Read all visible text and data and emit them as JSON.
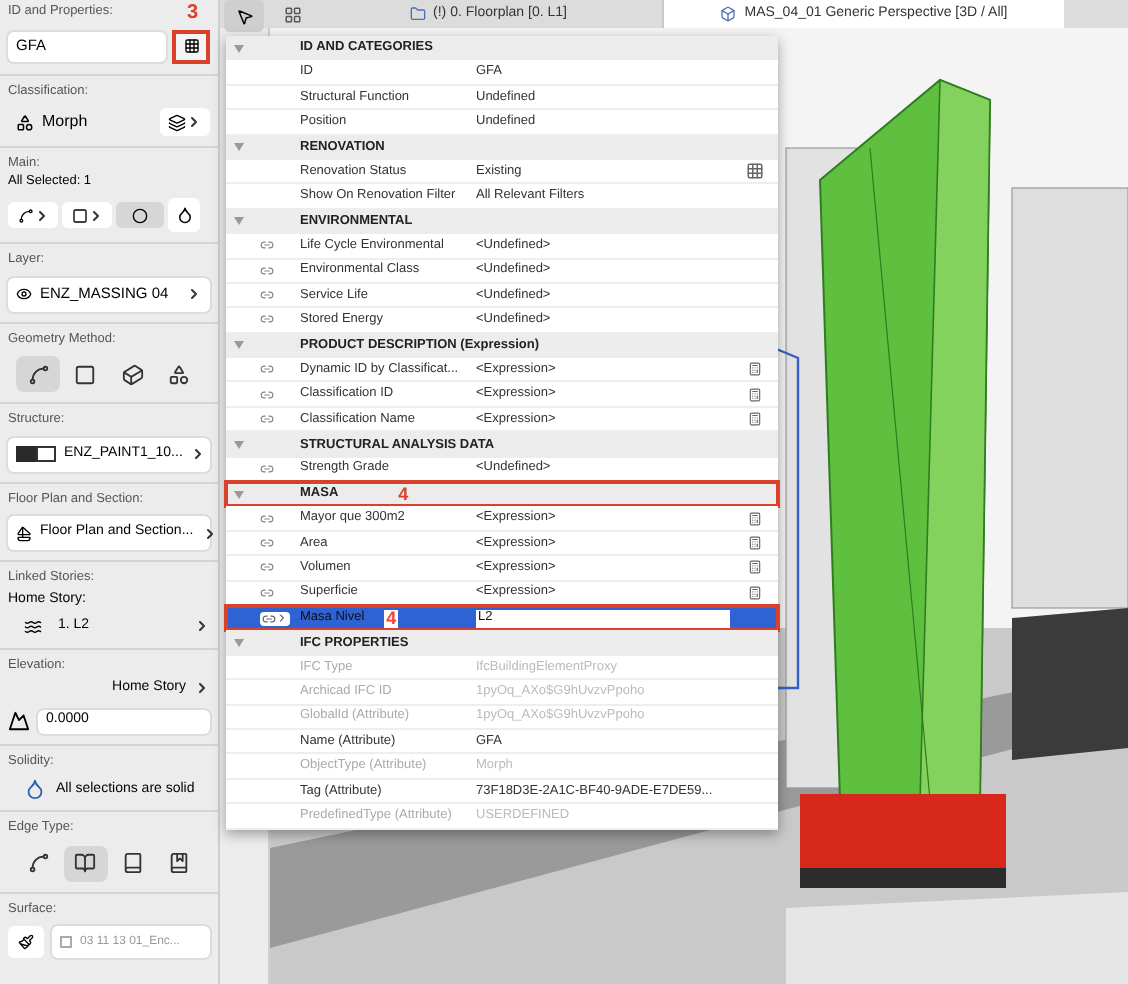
{
  "inspector": {
    "id_section": {
      "label": "ID and Properties:",
      "value": "GFA",
      "annotation": "3"
    },
    "classification": {
      "label": "Classification:",
      "value": "Morph"
    },
    "main": {
      "label": "Main:",
      "selection": "All Selected: 1"
    },
    "layer": {
      "label": "Layer:",
      "value": "ENZ_MASSING 04"
    },
    "geometry_method": {
      "label": "Geometry Method:",
      "options": [
        {
          "kind": "polyline",
          "selected": true
        },
        {
          "kind": "rectangle",
          "selected": false
        },
        {
          "kind": "box",
          "selected": false
        },
        {
          "kind": "freeform",
          "selected": false
        }
      ]
    },
    "structure": {
      "label": "Structure:",
      "value": "ENZ_PAINT1_10..."
    },
    "floor_plan": {
      "label": "Floor Plan and Section:",
      "value": "Floor Plan and Section..."
    },
    "linked_stories": {
      "label": "Linked Stories:",
      "home_story_label": "Home Story:",
      "value": "1. L2"
    },
    "elevation": {
      "label": "Elevation:",
      "reference": "Home Story",
      "value": "0.0000"
    },
    "solidity": {
      "label": "Solidity:",
      "text": "All selections are solid"
    },
    "edge_type": {
      "label": "Edge Type:",
      "options": [
        {
          "kind": "soft",
          "selected": false
        },
        {
          "kind": "open",
          "selected": true
        },
        {
          "kind": "half",
          "selected": false
        },
        {
          "kind": "closed",
          "selected": false
        }
      ]
    },
    "surface": {
      "label": "Surface:",
      "value": "03 11 13 01_Enc...",
      "disabled": true
    }
  },
  "tabs": [
    {
      "label": "(!) 0. Floorplan [0. L1]",
      "kind": "plan",
      "selected": false
    },
    {
      "label": "MAS_04_01 Generic Perspective [3D / All]",
      "kind": "perspective",
      "selected": true
    }
  ],
  "properties": {
    "groups": [
      {
        "title": "ID AND CATEGORIES",
        "expanded": true,
        "rows": [
          {
            "name": "ID",
            "value": "GFA",
            "kind": "text",
            "linked": false,
            "disabled": false,
            "selected": false
          },
          {
            "name": "Structural Function",
            "value": "Undefined",
            "kind": "text",
            "linked": false,
            "disabled": false,
            "selected": false
          },
          {
            "name": "Position",
            "value": "Undefined",
            "kind": "text",
            "linked": false,
            "disabled": false,
            "selected": false
          }
        ]
      },
      {
        "title": "RENOVATION",
        "expanded": true,
        "rows": [
          {
            "name": "Renovation Status",
            "value": "Existing",
            "kind": "renovation",
            "linked": false,
            "disabled": false,
            "selected": false
          },
          {
            "name": "Show On Renovation Filter",
            "value": "All Relevant Filters",
            "kind": "text",
            "linked": false,
            "disabled": false,
            "selected": false
          }
        ]
      },
      {
        "title": "ENVIRONMENTAL",
        "expanded": true,
        "rows": [
          {
            "name": "Life Cycle Environmental",
            "value": "<Undefined>",
            "kind": "text",
            "linked": true,
            "disabled": false,
            "selected": false
          },
          {
            "name": "Environmental Class",
            "value": "<Undefined>",
            "kind": "text",
            "linked": true,
            "disabled": false,
            "selected": false
          },
          {
            "name": "Service Life",
            "value": "<Undefined>",
            "kind": "text",
            "linked": true,
            "disabled": false,
            "selected": false
          },
          {
            "name": "Stored Energy",
            "value": "<Undefined>",
            "kind": "text",
            "linked": true,
            "disabled": false,
            "selected": false
          }
        ]
      },
      {
        "title": "PRODUCT DESCRIPTION (Expression)",
        "expanded": true,
        "rows": [
          {
            "name": "Dynamic ID by Classificat...",
            "value": "<Expression>",
            "kind": "expression",
            "linked": true,
            "disabled": false,
            "selected": false
          },
          {
            "name": "Classification ID",
            "value": "<Expression>",
            "kind": "expression",
            "linked": true,
            "disabled": false,
            "selected": false
          },
          {
            "name": "Classification Name",
            "value": "<Expression>",
            "kind": "expression",
            "linked": true,
            "disabled": false,
            "selected": false
          }
        ]
      },
      {
        "title": "STRUCTURAL ANALYSIS DATA",
        "expanded": true,
        "rows": [
          {
            "name": "Strength Grade",
            "value": "<Undefined>",
            "kind": "text",
            "linked": true,
            "disabled": false,
            "selected": false
          }
        ]
      },
      {
        "title": "MASA",
        "expanded": true,
        "annotation": "4",
        "rows": [
          {
            "name": "Mayor que 300m2",
            "value": "<Expression>",
            "kind": "expression",
            "linked": true,
            "disabled": false,
            "selected": false
          },
          {
            "name": "Area",
            "value": "<Expression>",
            "kind": "expression",
            "linked": true,
            "disabled": false,
            "selected": false
          },
          {
            "name": "Volumen",
            "value": "<Expression>",
            "kind": "expression",
            "linked": true,
            "disabled": false,
            "selected": false
          },
          {
            "name": "Superficie",
            "value": "<Expression>",
            "kind": "expression",
            "linked": true,
            "disabled": false,
            "selected": false
          },
          {
            "name": "Masa Nivel",
            "value": "L2",
            "kind": "text",
            "linked": true,
            "disabled": false,
            "selected": true,
            "annotation": "4"
          }
        ]
      },
      {
        "title": "IFC PROPERTIES",
        "expanded": true,
        "rows": [
          {
            "name": "IFC Type",
            "value": "IfcBuildingElementProxy",
            "kind": "text",
            "linked": false,
            "disabled": true,
            "selected": false
          },
          {
            "name": "Archicad IFC ID",
            "value": "1pyOq_AXo$G9hUvzvPpoho",
            "kind": "text",
            "linked": false,
            "disabled": true,
            "selected": false
          },
          {
            "name": "GlobalId (Attribute)",
            "value": "1pyOq_AXo$G9hUvzvPpoho",
            "kind": "text",
            "linked": false,
            "disabled": true,
            "selected": false
          },
          {
            "name": "Name (Attribute)",
            "value": "GFA",
            "kind": "text",
            "linked": false,
            "disabled": false,
            "selected": false
          },
          {
            "name": "ObjectType (Attribute)",
            "value": "Morph",
            "kind": "text",
            "linked": false,
            "disabled": true,
            "selected": false
          },
          {
            "name": "Tag (Attribute)",
            "value": "73F18D3E-2A1C-BF40-9ADE-E7DE59...",
            "kind": "text",
            "linked": false,
            "disabled": false,
            "selected": false
          },
          {
            "name": "PredefinedType (Attribute)",
            "value": "USERDEFINED",
            "kind": "text",
            "linked": false,
            "disabled": true,
            "selected": false
          }
        ]
      }
    ]
  }
}
